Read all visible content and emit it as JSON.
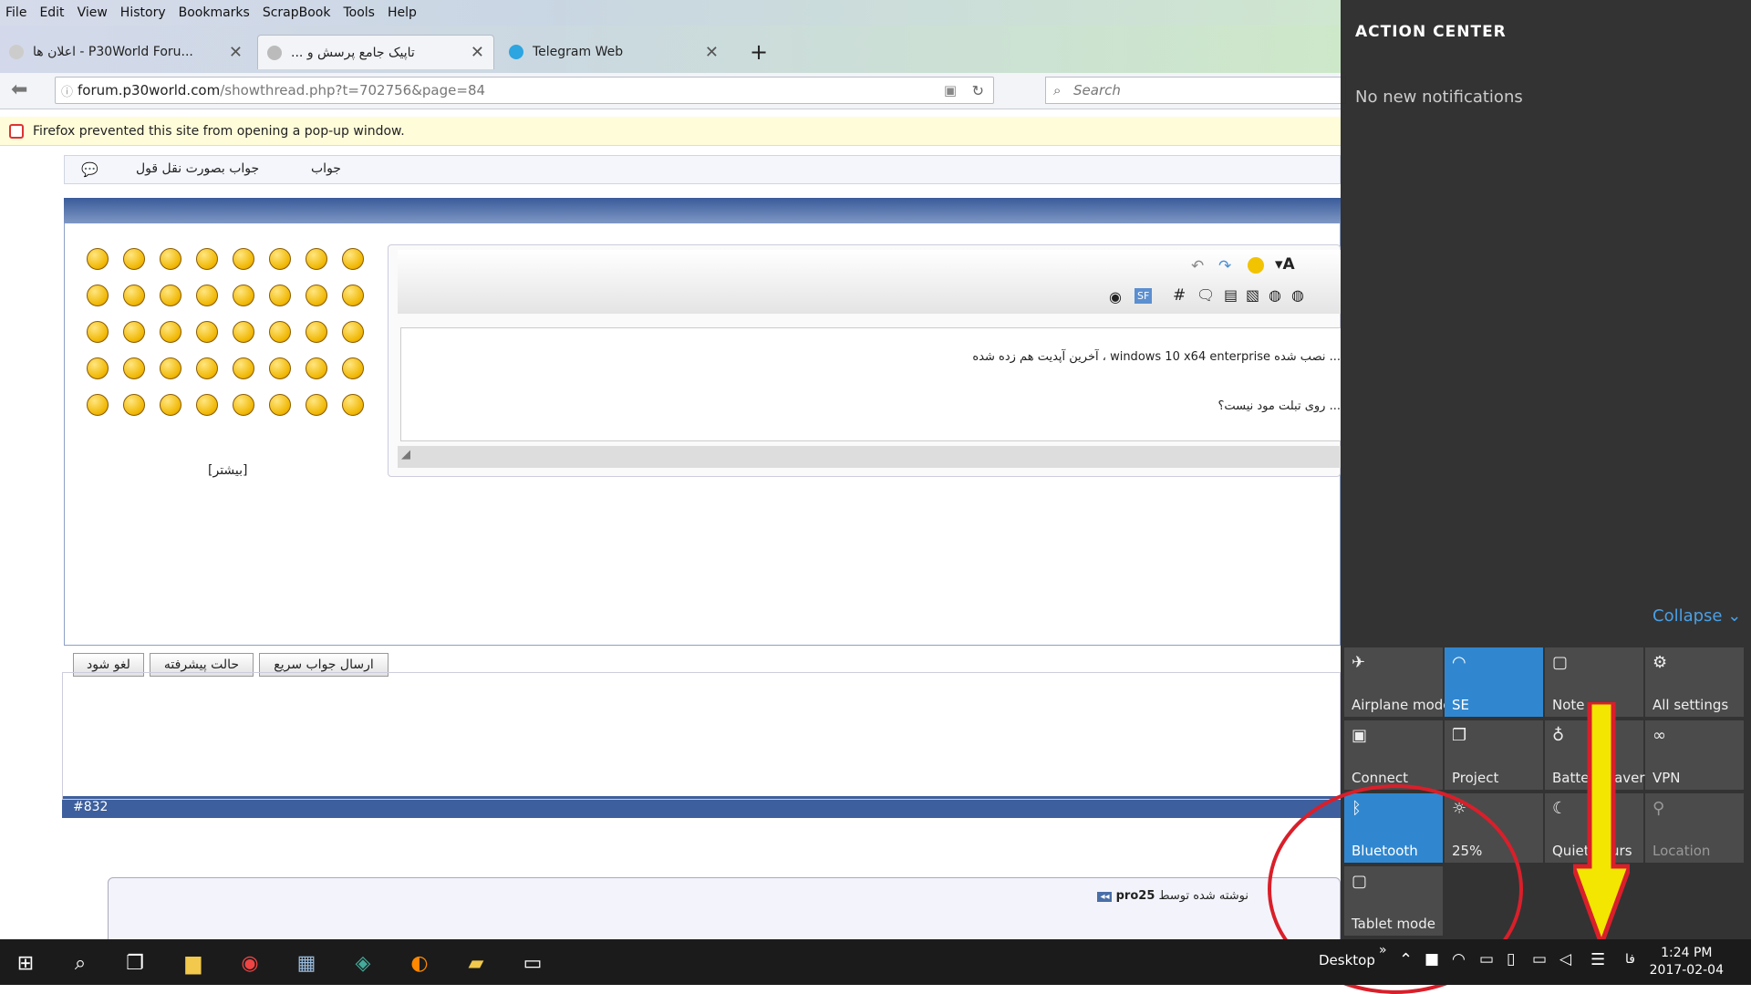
{
  "menu": [
    "File",
    "Edit",
    "View",
    "History",
    "Bookmarks",
    "ScrapBook",
    "Tools",
    "Help"
  ],
  "tabs": [
    {
      "label": "اعلان ها - P30World Foru..."
    },
    {
      "label": "... تاپیک جامع پرسش و"
    },
    {
      "label": "Telegram Web"
    }
  ],
  "url": {
    "host": "forum.p30world.com",
    "path": "/showthread.php?t=702756&page=84"
  },
  "search": {
    "placeholder": "Search"
  },
  "popup_notice": "Firefox prevented this site from opening a pop-up window.",
  "reply_bar": {
    "reply": "جواب",
    "quote_reply": "جواب بصورت نقل قول"
  },
  "smiley_more": "[بیشتر]",
  "editor": {
    "line1": "... نصب شده windows 10 x64 enterprise ، آخرین آپدیت هم زده شده",
    "line2": "... روی تبلت مود نیست؟"
  },
  "buttons": {
    "quick_reply": "ارسال جواب سریع",
    "advanced": "حالت پیشرفته",
    "cancel": "لغو شود"
  },
  "post": {
    "number": "#832",
    "quote_author": "pro25",
    "quote_prefix": "نوشته شده توسط"
  },
  "action_center": {
    "title": "ACTION CENTER",
    "empty": "No new notifications",
    "collapse": "Collapse",
    "tiles": [
      {
        "label": "Airplane mode",
        "icon": "airplane-icon",
        "state": "off"
      },
      {
        "label": "SE",
        "icon": "wifi-icon",
        "state": "on"
      },
      {
        "label": "Note",
        "icon": "note-icon",
        "state": "off"
      },
      {
        "label": "All settings",
        "icon": "gear-icon",
        "state": "off"
      },
      {
        "label": "Connect",
        "icon": "connect-icon",
        "state": "off"
      },
      {
        "label": "Project",
        "icon": "project-icon",
        "state": "off"
      },
      {
        "label": "Battery saver",
        "icon": "battery-saver-icon",
        "state": "off"
      },
      {
        "label": "VPN",
        "icon": "vpn-icon",
        "state": "off"
      },
      {
        "label": "Bluetooth",
        "icon": "bluetooth-icon",
        "state": "on"
      },
      {
        "label": "25%",
        "icon": "brightness-icon",
        "state": "off"
      },
      {
        "label": "Quiet hours",
        "icon": "moon-icon",
        "state": "off"
      },
      {
        "label": "Location",
        "icon": "location-icon",
        "state": "disabled"
      },
      {
        "label": "Tablet mode",
        "icon": "tablet-mode-icon",
        "state": "off"
      }
    ]
  },
  "taskbar": {
    "desktop": "Desktop",
    "lang": "فا",
    "time": "1:24 PM",
    "date": "2017-02-04"
  },
  "colors": {
    "accent": "#3087d0",
    "annotation_red": "#d91f2a",
    "annotation_yellow": "#f3e600"
  }
}
